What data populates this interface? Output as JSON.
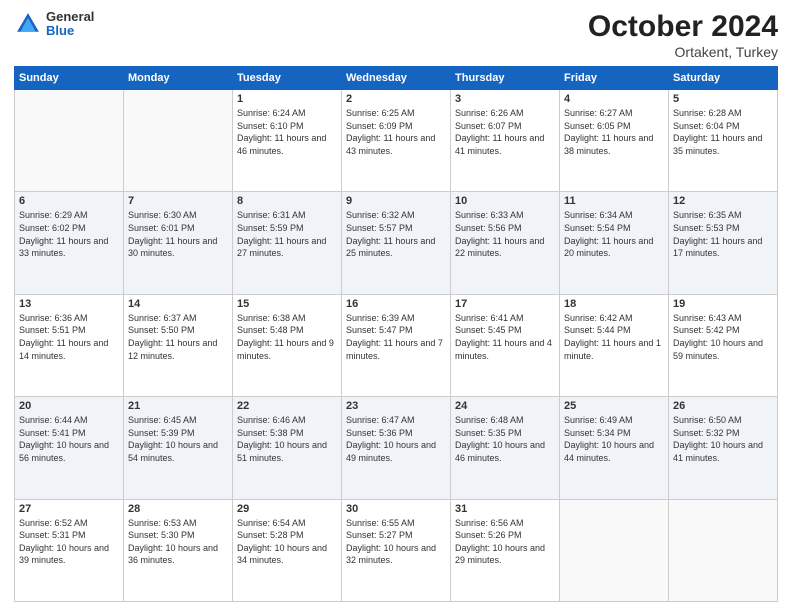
{
  "header": {
    "logo_general": "General",
    "logo_blue": "Blue",
    "month_title": "October 2024",
    "subtitle": "Ortakent, Turkey"
  },
  "weekdays": [
    "Sunday",
    "Monday",
    "Tuesday",
    "Wednesday",
    "Thursday",
    "Friday",
    "Saturday"
  ],
  "weeks": [
    [
      {
        "day": "",
        "info": ""
      },
      {
        "day": "",
        "info": ""
      },
      {
        "day": "1",
        "info": "Sunrise: 6:24 AM\nSunset: 6:10 PM\nDaylight: 11 hours and 46 minutes."
      },
      {
        "day": "2",
        "info": "Sunrise: 6:25 AM\nSunset: 6:09 PM\nDaylight: 11 hours and 43 minutes."
      },
      {
        "day": "3",
        "info": "Sunrise: 6:26 AM\nSunset: 6:07 PM\nDaylight: 11 hours and 41 minutes."
      },
      {
        "day": "4",
        "info": "Sunrise: 6:27 AM\nSunset: 6:05 PM\nDaylight: 11 hours and 38 minutes."
      },
      {
        "day": "5",
        "info": "Sunrise: 6:28 AM\nSunset: 6:04 PM\nDaylight: 11 hours and 35 minutes."
      }
    ],
    [
      {
        "day": "6",
        "info": "Sunrise: 6:29 AM\nSunset: 6:02 PM\nDaylight: 11 hours and 33 minutes."
      },
      {
        "day": "7",
        "info": "Sunrise: 6:30 AM\nSunset: 6:01 PM\nDaylight: 11 hours and 30 minutes."
      },
      {
        "day": "8",
        "info": "Sunrise: 6:31 AM\nSunset: 5:59 PM\nDaylight: 11 hours and 27 minutes."
      },
      {
        "day": "9",
        "info": "Sunrise: 6:32 AM\nSunset: 5:57 PM\nDaylight: 11 hours and 25 minutes."
      },
      {
        "day": "10",
        "info": "Sunrise: 6:33 AM\nSunset: 5:56 PM\nDaylight: 11 hours and 22 minutes."
      },
      {
        "day": "11",
        "info": "Sunrise: 6:34 AM\nSunset: 5:54 PM\nDaylight: 11 hours and 20 minutes."
      },
      {
        "day": "12",
        "info": "Sunrise: 6:35 AM\nSunset: 5:53 PM\nDaylight: 11 hours and 17 minutes."
      }
    ],
    [
      {
        "day": "13",
        "info": "Sunrise: 6:36 AM\nSunset: 5:51 PM\nDaylight: 11 hours and 14 minutes."
      },
      {
        "day": "14",
        "info": "Sunrise: 6:37 AM\nSunset: 5:50 PM\nDaylight: 11 hours and 12 minutes."
      },
      {
        "day": "15",
        "info": "Sunrise: 6:38 AM\nSunset: 5:48 PM\nDaylight: 11 hours and 9 minutes."
      },
      {
        "day": "16",
        "info": "Sunrise: 6:39 AM\nSunset: 5:47 PM\nDaylight: 11 hours and 7 minutes."
      },
      {
        "day": "17",
        "info": "Sunrise: 6:41 AM\nSunset: 5:45 PM\nDaylight: 11 hours and 4 minutes."
      },
      {
        "day": "18",
        "info": "Sunrise: 6:42 AM\nSunset: 5:44 PM\nDaylight: 11 hours and 1 minute."
      },
      {
        "day": "19",
        "info": "Sunrise: 6:43 AM\nSunset: 5:42 PM\nDaylight: 10 hours and 59 minutes."
      }
    ],
    [
      {
        "day": "20",
        "info": "Sunrise: 6:44 AM\nSunset: 5:41 PM\nDaylight: 10 hours and 56 minutes."
      },
      {
        "day": "21",
        "info": "Sunrise: 6:45 AM\nSunset: 5:39 PM\nDaylight: 10 hours and 54 minutes."
      },
      {
        "day": "22",
        "info": "Sunrise: 6:46 AM\nSunset: 5:38 PM\nDaylight: 10 hours and 51 minutes."
      },
      {
        "day": "23",
        "info": "Sunrise: 6:47 AM\nSunset: 5:36 PM\nDaylight: 10 hours and 49 minutes."
      },
      {
        "day": "24",
        "info": "Sunrise: 6:48 AM\nSunset: 5:35 PM\nDaylight: 10 hours and 46 minutes."
      },
      {
        "day": "25",
        "info": "Sunrise: 6:49 AM\nSunset: 5:34 PM\nDaylight: 10 hours and 44 minutes."
      },
      {
        "day": "26",
        "info": "Sunrise: 6:50 AM\nSunset: 5:32 PM\nDaylight: 10 hours and 41 minutes."
      }
    ],
    [
      {
        "day": "27",
        "info": "Sunrise: 6:52 AM\nSunset: 5:31 PM\nDaylight: 10 hours and 39 minutes."
      },
      {
        "day": "28",
        "info": "Sunrise: 6:53 AM\nSunset: 5:30 PM\nDaylight: 10 hours and 36 minutes."
      },
      {
        "day": "29",
        "info": "Sunrise: 6:54 AM\nSunset: 5:28 PM\nDaylight: 10 hours and 34 minutes."
      },
      {
        "day": "30",
        "info": "Sunrise: 6:55 AM\nSunset: 5:27 PM\nDaylight: 10 hours and 32 minutes."
      },
      {
        "day": "31",
        "info": "Sunrise: 6:56 AM\nSunset: 5:26 PM\nDaylight: 10 hours and 29 minutes."
      },
      {
        "day": "",
        "info": ""
      },
      {
        "day": "",
        "info": ""
      }
    ]
  ]
}
